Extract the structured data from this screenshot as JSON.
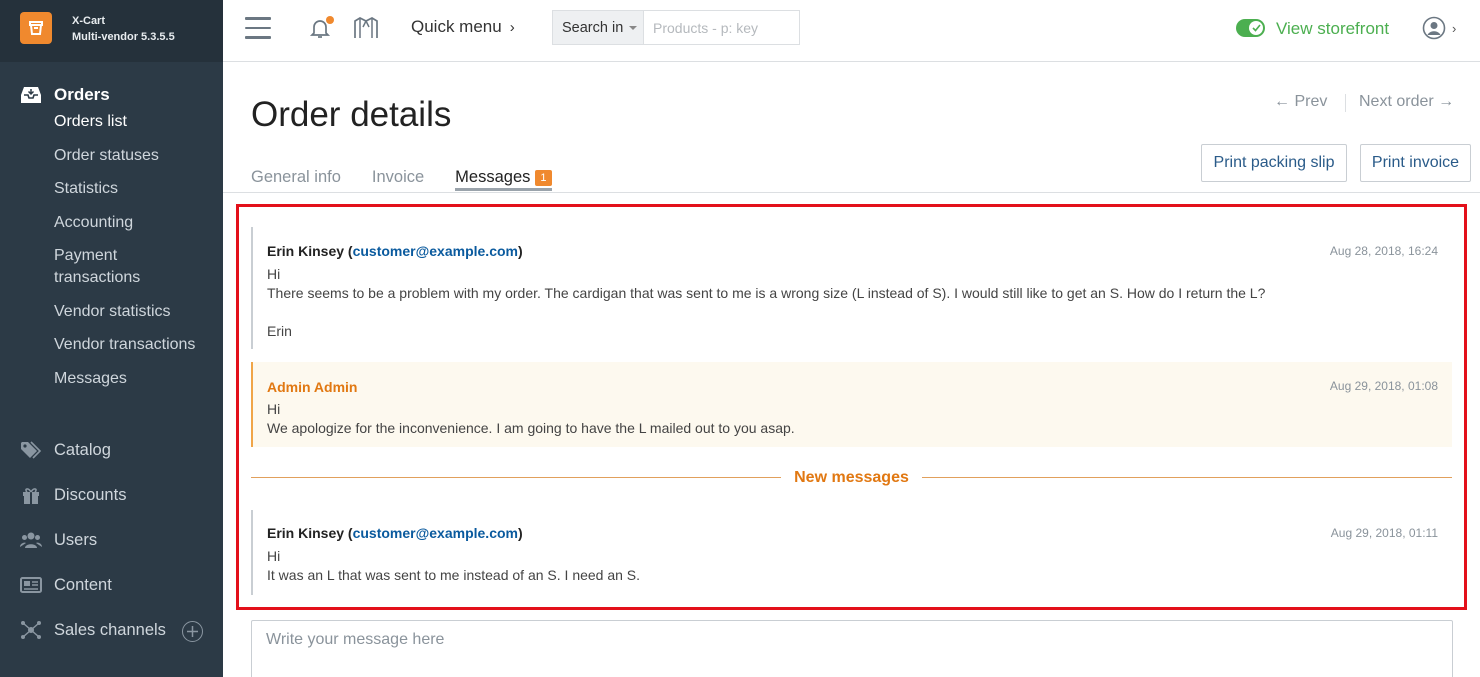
{
  "brand": {
    "name": "X-Cart",
    "edition": "Multi-vendor 5.3.5.5"
  },
  "sidebar": {
    "orders": {
      "label": "Orders",
      "items": [
        "Orders list",
        "Order statuses",
        "Statistics",
        "Accounting",
        "Payment transactions",
        "Vendor statistics",
        "Vendor transactions",
        "Messages"
      ]
    },
    "catalog": "Catalog",
    "discounts": "Discounts",
    "users": "Users",
    "content": "Content",
    "sales_channels": "Sales channels"
  },
  "topbar": {
    "quick_menu": "Quick menu",
    "search_in": "Search in",
    "search_placeholder": "Products - p: key",
    "view_storefront": "View storefront"
  },
  "page": {
    "title": "Order details",
    "prev": "← Prev",
    "next": "Next order →",
    "print_packing_slip": "Print packing slip",
    "print_invoice": "Print invoice",
    "tabs": [
      {
        "label": "General info"
      },
      {
        "label": "Invoice"
      },
      {
        "label": "Messages",
        "badge": "1"
      }
    ]
  },
  "messages": [
    {
      "author": "Erin Kinsey",
      "email": "customer@example.com",
      "date": "Aug 28, 2018, 16:24",
      "lines": [
        "Hi",
        "There seems to be a problem with my order. The cardigan that was sent to me is a wrong size (L instead of S). I would still like to get an S. How do I return the L?",
        "Erin"
      ]
    },
    {
      "author": "Admin Admin",
      "date": "Aug 29, 2018, 01:08",
      "lines": [
        "Hi",
        "We apologize for the inconvenience. I am going to have the L mailed out to you asap."
      ]
    },
    {
      "author": "Erin Kinsey",
      "email": "customer@example.com",
      "date": "Aug 29, 2018, 01:11",
      "lines": [
        "Hi",
        "It was an L that was sent to me instead of an S. I need an S."
      ]
    }
  ],
  "new_messages_label": "New messages",
  "compose_placeholder": "Write your message here",
  "colors": {
    "accent": "#f0892e",
    "sidebar": "#2c3a46",
    "storefront_green": "#4caf50",
    "highlight_border": "#e3101a",
    "link": "#0a5a9e"
  }
}
